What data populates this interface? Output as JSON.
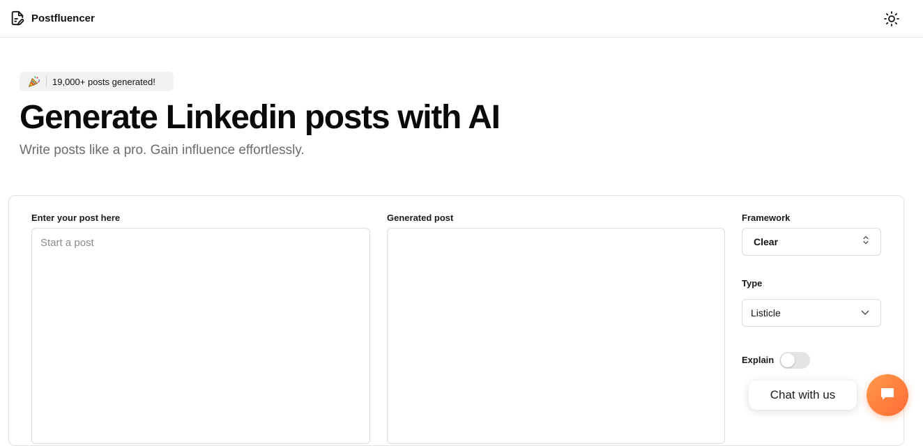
{
  "header": {
    "brand_name": "Postfluencer",
    "brand_icon": "file-pen-icon",
    "theme_icon": "sun-icon"
  },
  "badge": {
    "emoji_icon": "party-popper-icon",
    "text": "19,000+ posts generated!"
  },
  "hero": {
    "title": "Generate Linkedin posts with AI",
    "subtitle": "Write posts like a pro. Gain influence effortlessly."
  },
  "editor": {
    "input_label": "Enter your post here",
    "input_placeholder": "Start a post",
    "input_value": "",
    "output_label": "Generated post",
    "output_value": ""
  },
  "options": {
    "framework_label": "Framework",
    "framework_value": "Clear",
    "type_label": "Type",
    "type_value": "Listicle",
    "explain_label": "Explain",
    "explain_enabled": false
  },
  "chat": {
    "bubble_text": "Chat with us",
    "launcher_icon": "chat-icon",
    "accent_color": "#ff7a3d"
  }
}
